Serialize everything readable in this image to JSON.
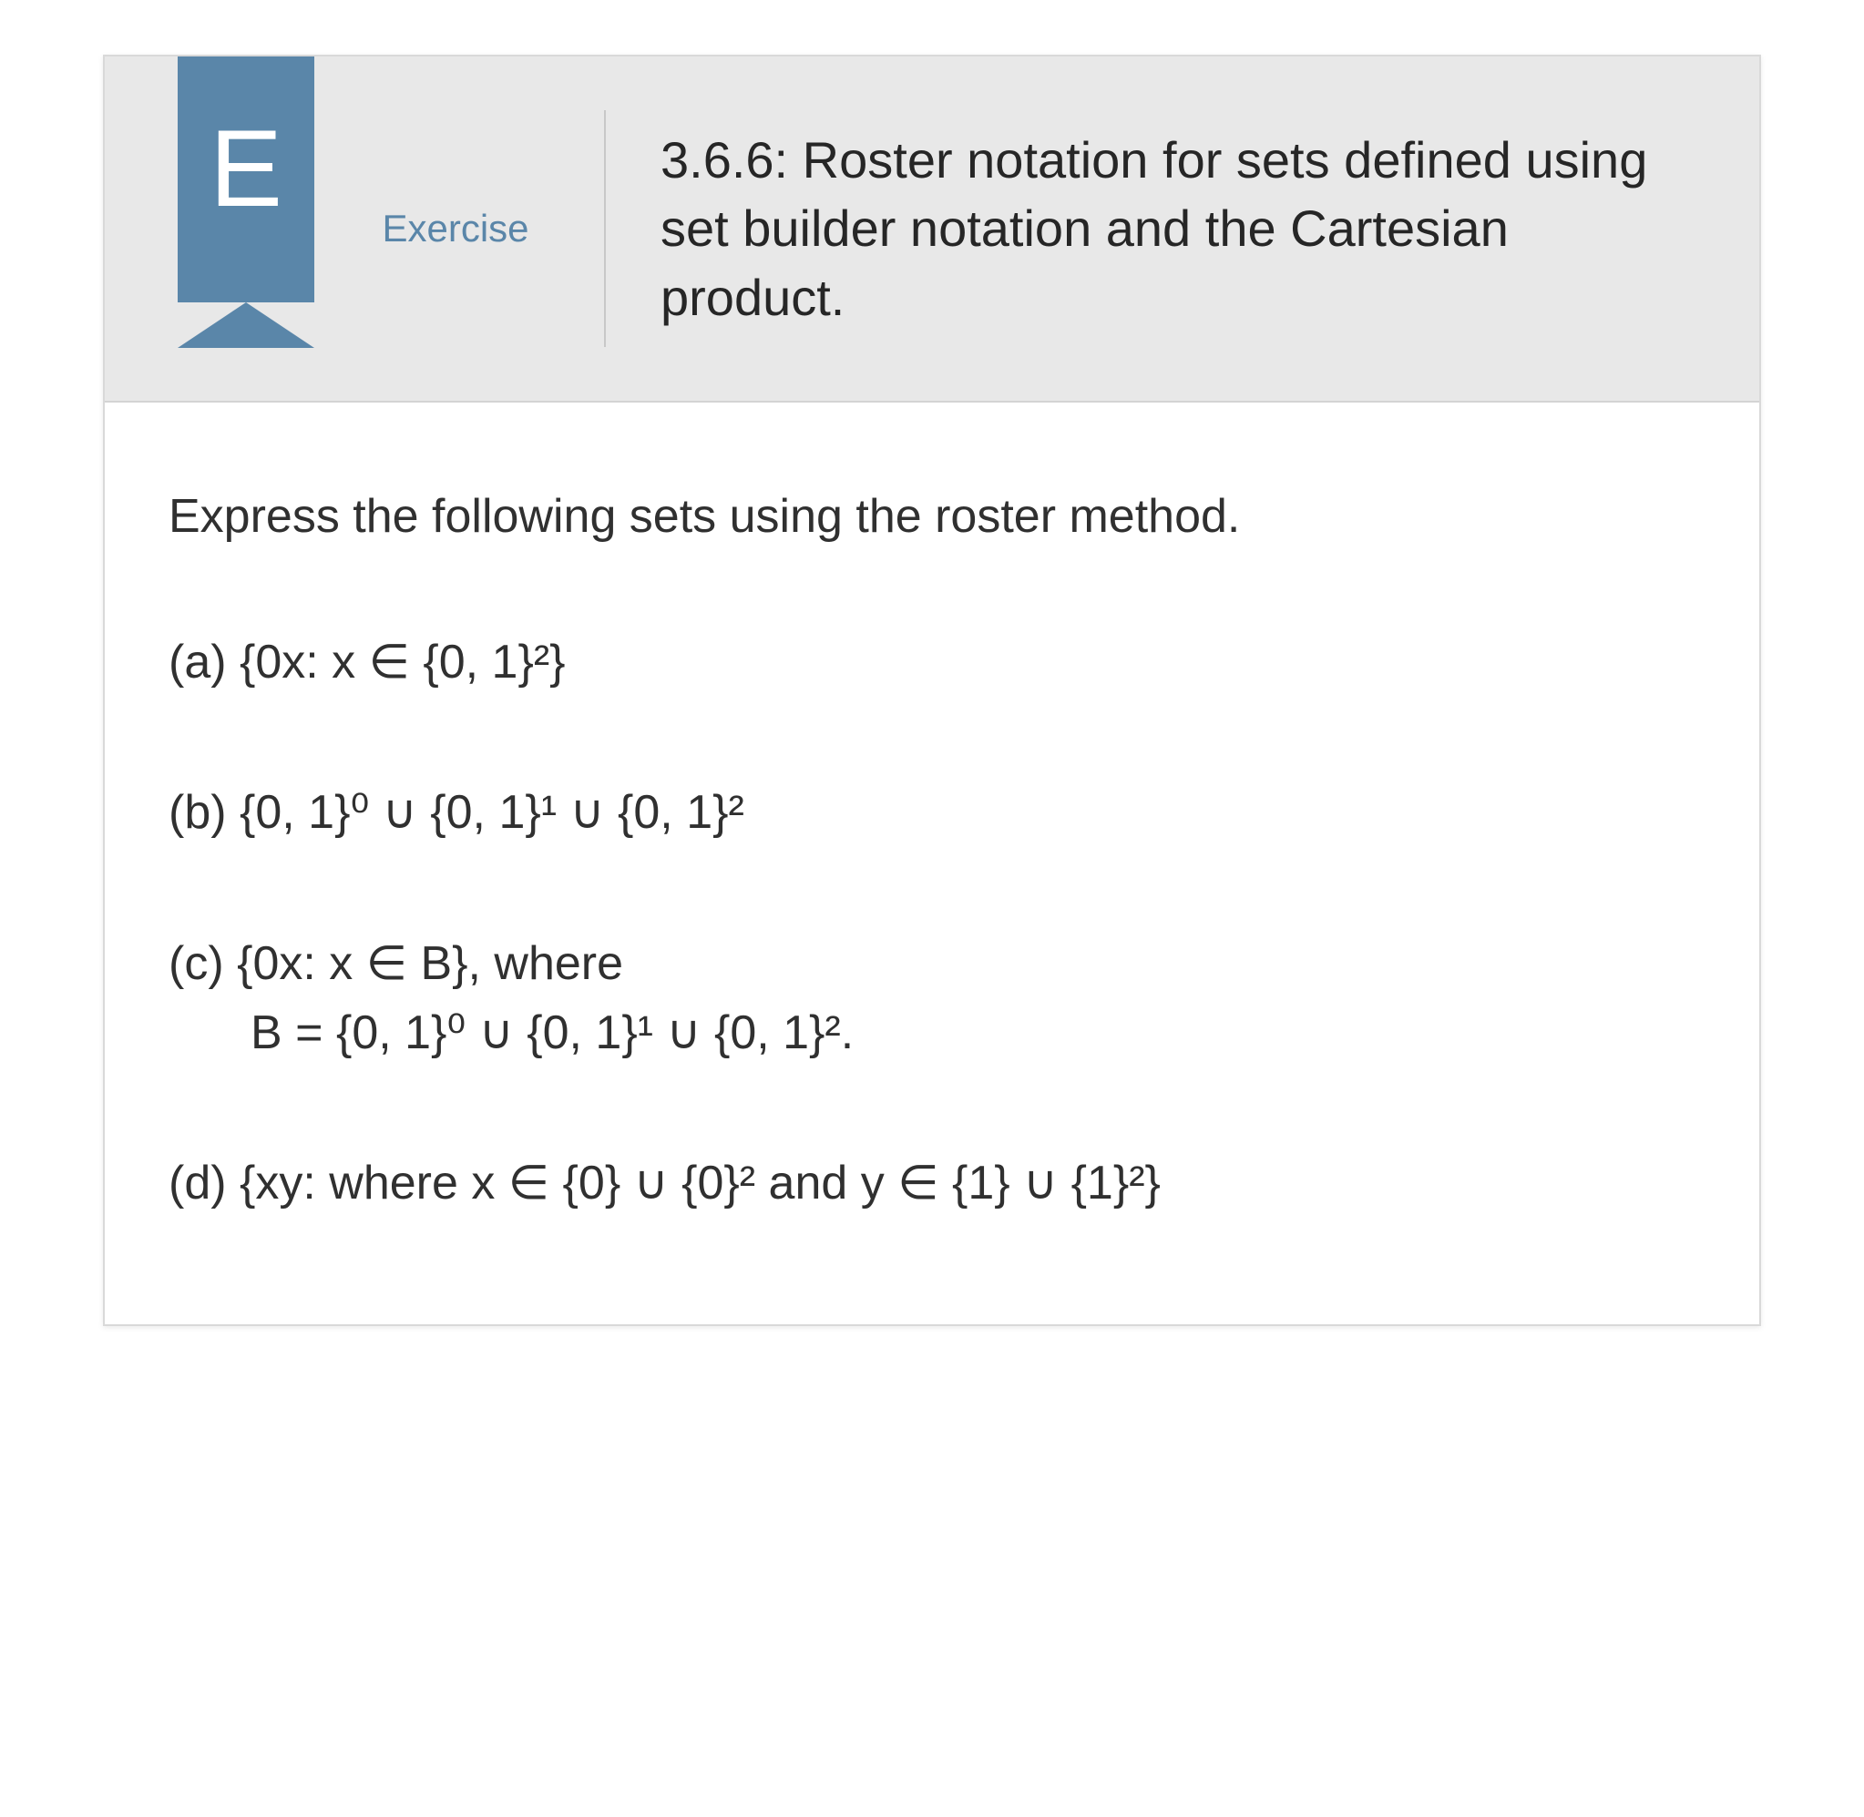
{
  "badge": {
    "letter": "E",
    "label": "Exercise"
  },
  "title": "3.6.6: Roster notation for sets defined using set builder notation and the Cartesian product.",
  "prompt": "Express the following sets using the roster method.",
  "items": {
    "a": "(a) {0x: x ∈ {0, 1}²}",
    "b": "(b) {0, 1}⁰ ∪ {0, 1}¹ ∪ {0, 1}²",
    "c_line1": "(c) {0x: x ∈ B}, where",
    "c_line2": "B = {0, 1}⁰ ∪ {0, 1}¹ ∪ {0, 1}².",
    "d": "(d) {xy: where x ∈ {0} ∪ {0}² and y ∈ {1} ∪ {1}²}"
  }
}
